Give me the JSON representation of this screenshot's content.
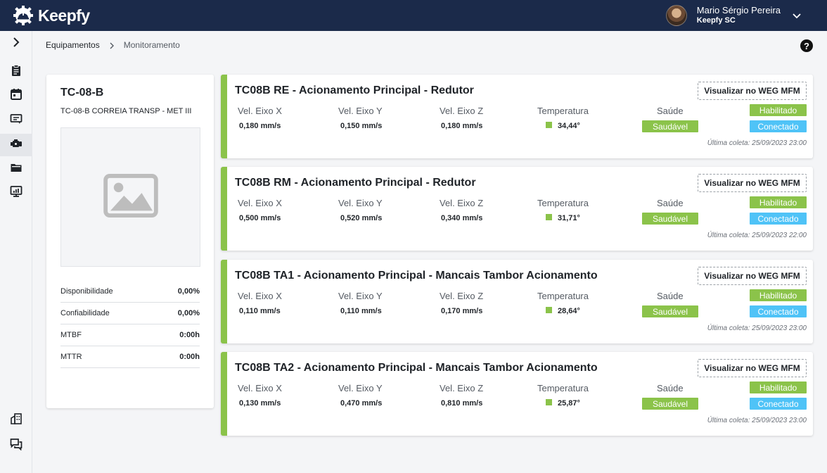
{
  "header": {
    "brand": "Keepfy",
    "user_name": "Mario Sérgio Pereira",
    "user_company": "Keepfy SC",
    "bg_color": "#1b2a4a"
  },
  "sidebar": {
    "items": [
      {
        "icon": "chevron-right-icon"
      },
      {
        "icon": "clipboard-icon"
      },
      {
        "icon": "calendar-icon"
      },
      {
        "icon": "ticket-icon"
      },
      {
        "icon": "equipment-icon",
        "active": true
      },
      {
        "icon": "folder-icon"
      },
      {
        "icon": "monitor-chart-icon"
      },
      {
        "icon": "building-icon"
      },
      {
        "icon": "chat-icon"
      }
    ]
  },
  "breadcrumb": {
    "items": [
      "Equipamentos",
      "Monitoramento"
    ]
  },
  "help_label": "?",
  "equipment": {
    "title": "TC-08-B",
    "description": "TC-08-B CORREIA TRANSP - MET III",
    "metrics": [
      {
        "label": "Disponibilidade",
        "value": "0,00%"
      },
      {
        "label": "Confiabilidade",
        "value": "0,00%"
      },
      {
        "label": "MTBF",
        "value": "0:00h"
      },
      {
        "label": "MTTR",
        "value": "0:00h"
      }
    ]
  },
  "labels": {
    "vel_x": "Vel. Eixo X",
    "vel_y": "Vel. Eixo Y",
    "vel_z": "Vel. Eixo Z",
    "temperature": "Temperatura",
    "health": "Saúde",
    "weg_button": "Visualizar no WEG MFM"
  },
  "sensors": [
    {
      "title": "TC08B RE - Acionamento Principal - Redutor",
      "vel_x": "0,180 mm/s",
      "vel_y": "0,150 mm/s",
      "vel_z": "0,180 mm/s",
      "temperature": "34,44°",
      "health": "Saudável",
      "status": "Habilitado",
      "connection": "Conectado",
      "last_collect": "Última coleta: 25/09/2023 23:00"
    },
    {
      "title": "TC08B RM - Acionamento Principal - Redutor",
      "vel_x": "0,500 mm/s",
      "vel_y": "0,520 mm/s",
      "vel_z": "0,340 mm/s",
      "temperature": "31,71°",
      "health": "Saudável",
      "status": "Habilitado",
      "connection": "Conectado",
      "last_collect": "Última coleta: 25/09/2023 22:00"
    },
    {
      "title": "TC08B TA1 - Acionamento Principal - Mancais Tambor Acionamento",
      "vel_x": "0,110 mm/s",
      "vel_y": "0,110 mm/s",
      "vel_z": "0,170 mm/s",
      "temperature": "28,64°",
      "health": "Saudável",
      "status": "Habilitado",
      "connection": "Conectado",
      "last_collect": "Última coleta: 25/09/2023 23:00"
    },
    {
      "title": "TC08B TA2 - Acionamento Principal - Mancais Tambor Acionamento",
      "vel_x": "0,130 mm/s",
      "vel_y": "0,470 mm/s",
      "vel_z": "0,810 mm/s",
      "temperature": "25,87°",
      "health": "Saudável",
      "status": "Habilitado",
      "connection": "Conectado",
      "last_collect": "Última coleta: 25/09/2023 23:00"
    }
  ],
  "colors": {
    "healthy": "#8bc34a",
    "connected": "#4fc3f7"
  }
}
